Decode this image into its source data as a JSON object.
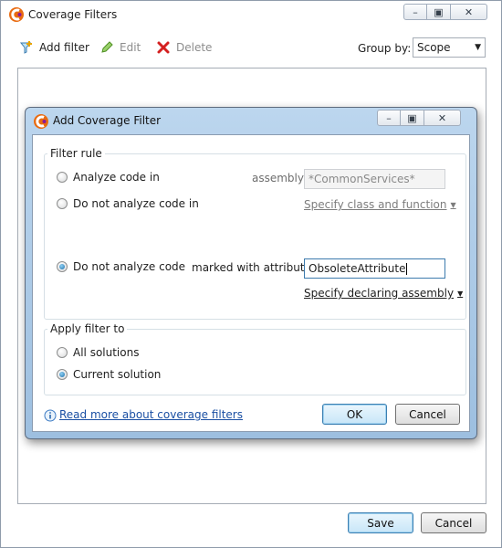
{
  "window": {
    "title": "Coverage Filters",
    "icon": "dotcover-icon",
    "controls": {
      "minimize": "minimize-icon",
      "maximize": "maximize-icon",
      "close": "close-icon"
    }
  },
  "toolbar": {
    "add_label": "Add filter",
    "edit_label": "Edit",
    "delete_label": "Delete",
    "group_by_label": "Group by:",
    "group_by_value": "Scope"
  },
  "footer": {
    "save_label": "Save",
    "cancel_label": "Cancel"
  },
  "dialog": {
    "title": "Add Coverage Filter",
    "filter_rule": {
      "legend": "Filter rule",
      "option_analyze": "Analyze code in",
      "option_not_analyze_in": "Do not analyze code in",
      "option_not_analyze_attr": "Do not analyze code",
      "assembly_label": "assembly",
      "assembly_value": "*CommonServices*",
      "specify_class_link": "Specify class and function",
      "marked_label": "marked with attribute",
      "attribute_value": "ObsoleteAttribute",
      "specify_assembly_link": "Specify declaring assembly",
      "selected": "not_analyze_attr"
    },
    "apply_to": {
      "legend": "Apply filter to",
      "option_all": "All solutions",
      "option_current": "Current solution",
      "selected": "current"
    },
    "read_more_link": "Read more about coverage filters",
    "ok_label": "OK",
    "cancel_label": "Cancel"
  },
  "colors": {
    "accent": "#1a4fa3",
    "dialog_frame": "#a9c9e8",
    "add_icon": "#e8a400",
    "edit_icon": "#5aab2e",
    "delete_icon": "#d42020"
  }
}
